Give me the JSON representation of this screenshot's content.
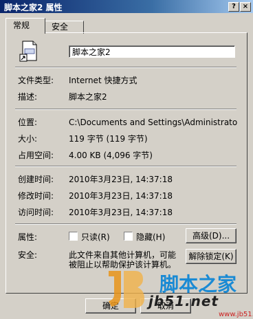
{
  "window": {
    "title": "脚本之家2 属性",
    "help_btn": "?",
    "close_btn": "×"
  },
  "tabs": [
    {
      "label": "常规"
    },
    {
      "label": "安全"
    }
  ],
  "general": {
    "file_name": "脚本之家2",
    "rows1": [
      {
        "label": "文件类型:",
        "value": "Internet 快捷方式"
      },
      {
        "label": "描述:",
        "value": "脚本之家2"
      }
    ],
    "rows2": [
      {
        "label": "位置:",
        "value": "C:\\Documents and Settings\\Administrator\\桌"
      },
      {
        "label": "大小:",
        "value": "119 字节 (119 字节)"
      },
      {
        "label": "占用空间:",
        "value": "4.00 KB (4,096 字节)"
      }
    ],
    "rows3": [
      {
        "label": "创建时间:",
        "value": "2010年3月23日, 14:37:18"
      },
      {
        "label": "修改时间:",
        "value": "2010年3月23日, 14:37:18"
      },
      {
        "label": "访问时间:",
        "value": "2010年3月23日, 14:37:18"
      }
    ],
    "attributes": {
      "label": "属性:",
      "readonly": "只读(R)",
      "hidden": "隐藏(H)",
      "advanced_btn": "高级(D)..."
    },
    "security": {
      "label": "安全:",
      "text_line1": "此文件来自其他计算机，可能",
      "text_line2": "被阻止以帮助保护该计算机。",
      "unblock_btn": "解除锁定(K)"
    }
  },
  "footer": {
    "ok_btn": "确定",
    "cancel_btn": "取消"
  },
  "watermark": {
    "brand": "脚本之家",
    "url": "jb51.net",
    "url_small": "www.jb51.net"
  }
}
